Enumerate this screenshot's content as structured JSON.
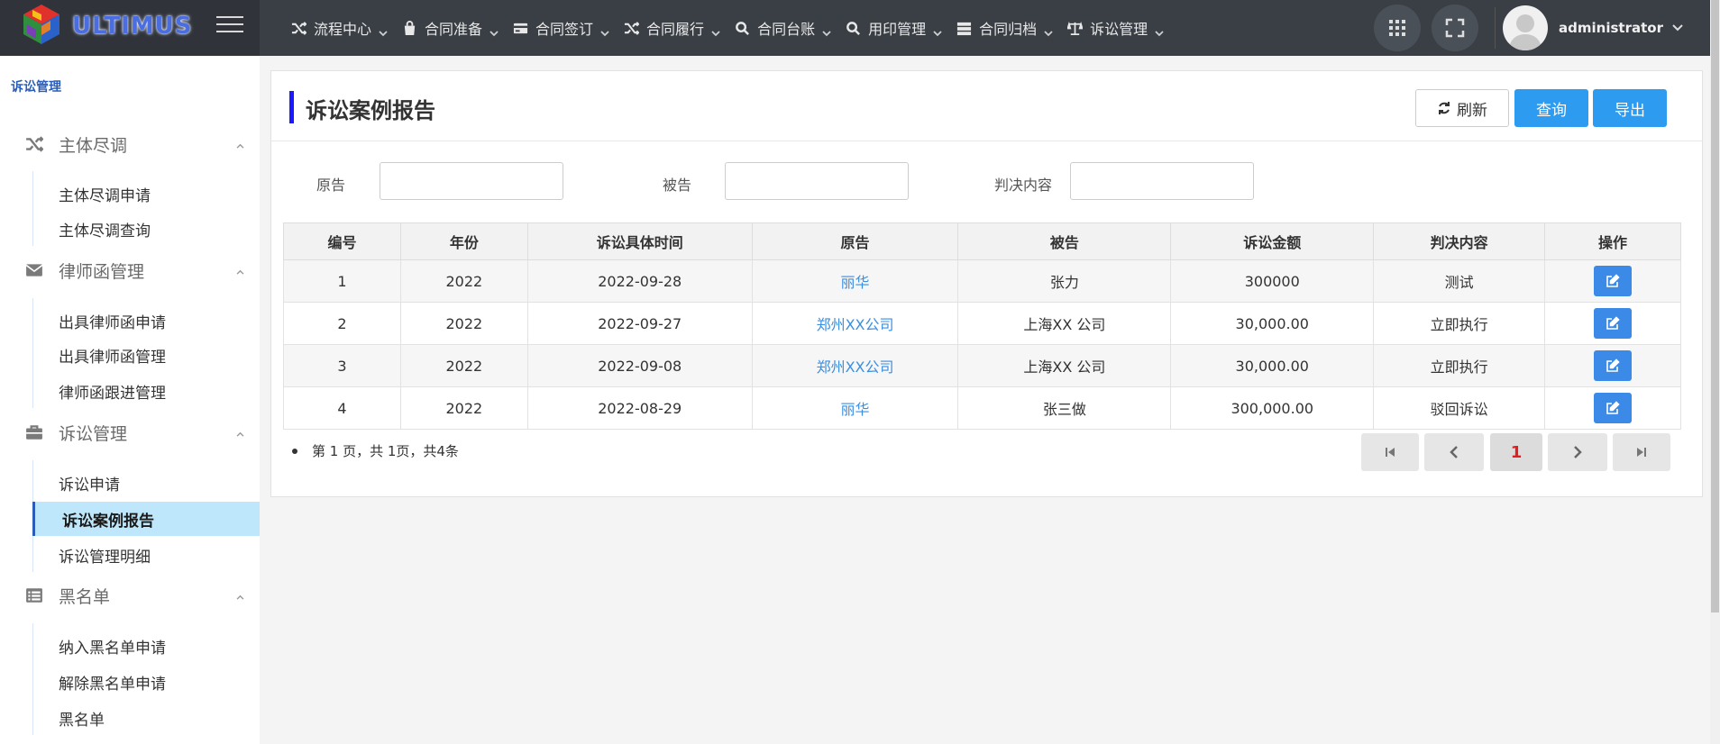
{
  "app": {
    "logo_text": "ULTIMUS"
  },
  "nav": [
    {
      "label": "流程中心",
      "icon": "shuffle-icon"
    },
    {
      "label": "合同准备",
      "icon": "bag-icon"
    },
    {
      "label": "合同签订",
      "icon": "credit-card-icon"
    },
    {
      "label": "合同履行",
      "icon": "shuffle-icon"
    },
    {
      "label": "合同台账",
      "icon": "search-icon"
    },
    {
      "label": "用印管理",
      "icon": "search-icon"
    },
    {
      "label": "合同归档",
      "icon": "server-icon"
    },
    {
      "label": "诉讼管理",
      "icon": "balance-scale-icon"
    }
  ],
  "user": {
    "name": "administrator"
  },
  "sidebar": {
    "section_title": "诉讼管理",
    "groups": [
      {
        "label": "主体尽调",
        "icon": "shuffle-icon",
        "items": [
          "主体尽调申请",
          "主体尽调查询"
        ]
      },
      {
        "label": "律师函管理",
        "icon": "envelope-icon",
        "items": [
          "出具律师函申请",
          "出具律师函管理",
          "律师函跟进管理"
        ]
      },
      {
        "label": "诉讼管理",
        "icon": "briefcase-icon",
        "items": [
          "诉讼申请",
          "诉讼案例报告",
          "诉讼管理明细"
        ]
      },
      {
        "label": "黑名单",
        "icon": "list-icon",
        "items": [
          "纳入黑名单申请",
          "解除黑名单申请",
          "黑名单"
        ]
      }
    ],
    "active_item": "诉讼案例报告"
  },
  "page": {
    "title": "诉讼案例报告",
    "buttons": {
      "refresh": "刷新",
      "query": "查询",
      "export": "导出"
    },
    "filters": {
      "plaintiff": "原告",
      "defendant": "被告",
      "judgment": "判决内容"
    }
  },
  "table": {
    "headers": [
      "编号",
      "年份",
      "诉讼具体时间",
      "原告",
      "被告",
      "诉讼金额",
      "判决内容",
      "操作"
    ],
    "rows": [
      [
        "1",
        "2022",
        "2022-09-28",
        "丽华",
        "张力",
        "300000",
        "测试"
      ],
      [
        "2",
        "2022",
        "2022-09-27",
        "郑州XX公司",
        "上海XX 公司",
        "30,000.00",
        "立即执行"
      ],
      [
        "3",
        "2022",
        "2022-09-08",
        "郑州XX公司",
        "上海XX 公司",
        "30,000.00",
        "立即执行"
      ],
      [
        "4",
        "2022",
        "2022-08-29",
        "丽华",
        "张三做",
        "300,000.00",
        "驳回诉讼"
      ]
    ]
  },
  "pagination": {
    "info": "第 1 页，共 1页，共4条",
    "current_page": "1"
  },
  "colors": {
    "topbar": "#3a3f46",
    "accent": "#2d9bf0",
    "active_bg": "#bfe7fb",
    "link": "#3b8fe0"
  }
}
